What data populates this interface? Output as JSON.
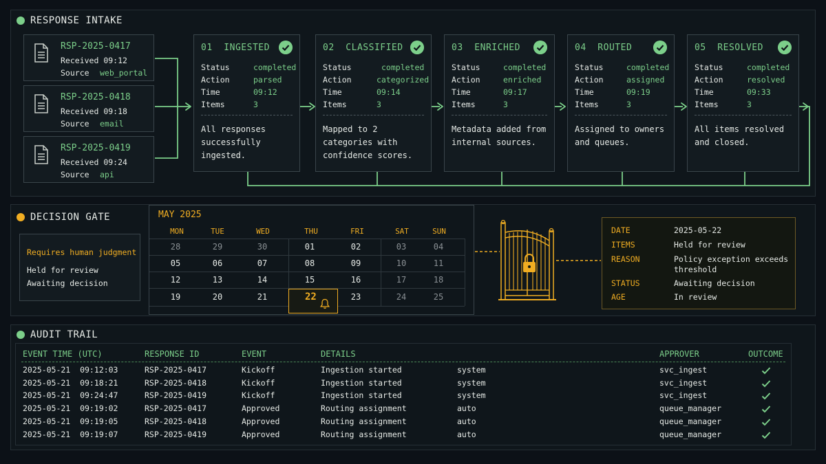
{
  "sections": {
    "intake_title": "RESPONSE INTAKE",
    "gate_title": "DECISION GATE",
    "audit_title": "AUDIT TRAIL"
  },
  "colors": {
    "accent_green": "#7ccf8a",
    "accent_amber": "#f0ad22",
    "background": "#0c1117"
  },
  "responses": [
    {
      "id": "RSP-2025-0417",
      "received_label": "Received",
      "received": "09:12",
      "source_label": "Source",
      "source": "web_portal",
      "icon": "document-icon"
    },
    {
      "id": "RSP-2025-0418",
      "received_label": "Received",
      "received": "09:18",
      "source_label": "Source",
      "source": "email",
      "icon": "document-icon"
    },
    {
      "id": "RSP-2025-0419",
      "received_label": "Received",
      "received": "09:24",
      "source_label": "Source",
      "source": "api",
      "icon": "document-icon"
    }
  ],
  "stages": [
    {
      "title": "01  INGESTED",
      "status": "completed",
      "action": "parsed",
      "time": "09:12",
      "items": "3",
      "note": "All responses successfully ingested."
    },
    {
      "title": "02  CLASSIFIED",
      "status": "completed",
      "action": "categorized",
      "time": "09:14",
      "items": "3",
      "note": "Mapped to 2 categories with confidence scores."
    },
    {
      "title": "03  ENRICHED",
      "status": "completed",
      "action": "enriched",
      "time": "09:17",
      "items": "3",
      "note": "Metadata added from internal sources."
    },
    {
      "title": "04  ROUTED",
      "status": "completed",
      "action": "assigned",
      "time": "09:19",
      "items": "3",
      "note": "Assigned to owners and queues."
    },
    {
      "title": "05  RESOLVED",
      "status": "completed",
      "action": "resolved",
      "time": "09:33",
      "items": "3",
      "note": "All items resolved and closed."
    }
  ],
  "stage_labels": {
    "status": "Status",
    "action": "Action",
    "time": "Time",
    "items": "Items"
  },
  "judgment": {
    "heading": "Requires human judgment",
    "line1": "Held for review",
    "line2": "Awaiting decision"
  },
  "calendar": {
    "month": "MAY 2025",
    "days_of_week": [
      "MON",
      "TUE",
      "WED",
      "THU",
      "FRI",
      "SAT",
      "SUN"
    ],
    "weeks": [
      [
        "28",
        "29",
        "30",
        "01",
        "02",
        "03",
        "04"
      ],
      [
        "05",
        "06",
        "07",
        "08",
        "09",
        "10",
        "11"
      ],
      [
        "12",
        "13",
        "14",
        "15",
        "16",
        "17",
        "18"
      ],
      [
        "19",
        "20",
        "21",
        "22",
        "23",
        "24",
        "25"
      ]
    ],
    "selected": "22"
  },
  "gate_detail": {
    "date_label": "DATE",
    "date": "2025-05-22",
    "items_label": "ITEMS",
    "items": "Held for review",
    "reason_label": "REASON",
    "reason": "Policy exception exceeds threshold",
    "status_label": "STATUS",
    "status": "Awaiting decision",
    "age_label": "AGE",
    "age": "In review"
  },
  "audit": {
    "columns": [
      "EVENT TIME (UTC)",
      "RESPONSE ID",
      "EVENT",
      "DETAILS",
      "APPROVER",
      "OUTCOME"
    ],
    "rows": [
      {
        "time": "2025-05-21  09:12:03",
        "id": "RSP-2025-0417",
        "event": "Kickoff",
        "details": "Ingestion started",
        "actor": "system",
        "approver": "svc_ingest",
        "outcome": "check"
      },
      {
        "time": "2025-05-21  09:18:21",
        "id": "RSP-2025-0418",
        "event": "Kickoff",
        "details": "Ingestion started",
        "actor": "system",
        "approver": "svc_ingest",
        "outcome": "check"
      },
      {
        "time": "2025-05-21  09:24:47",
        "id": "RSP-2025-0419",
        "event": "Kickoff",
        "details": "Ingestion started",
        "actor": "system",
        "approver": "svc_ingest",
        "outcome": "check"
      },
      {
        "time": "2025-05-21  09:19:02",
        "id": "RSP-2025-0417",
        "event": "Approved",
        "details": "Routing assignment",
        "actor": "auto",
        "approver": "queue_manager",
        "outcome": "check"
      },
      {
        "time": "2025-05-21  09:19:05",
        "id": "RSP-2025-0418",
        "event": "Approved",
        "details": "Routing assignment",
        "actor": "auto",
        "approver": "queue_manager",
        "outcome": "check"
      },
      {
        "time": "2025-05-21  09:19:07",
        "id": "RSP-2025-0419",
        "event": "Approved",
        "details": "Routing assignment",
        "actor": "auto",
        "approver": "queue_manager",
        "outcome": "check"
      }
    ]
  }
}
